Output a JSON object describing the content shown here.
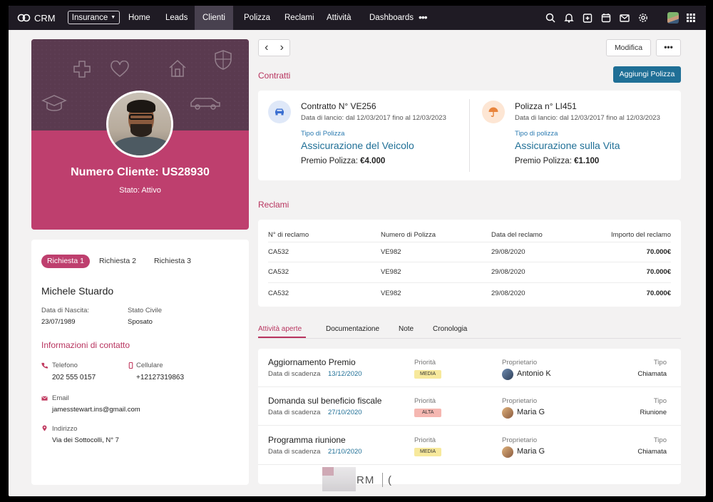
{
  "nav": {
    "logo_text": "CRM",
    "app_selector": "Insurance",
    "items": [
      "Home",
      "Leads",
      "Clienti",
      "Polizza",
      "Reclami",
      "Attività",
      "Dashboards"
    ],
    "active": "Clienti",
    "more": "•••",
    "icons": [
      "search-icon",
      "bell-icon",
      "add-note-icon",
      "calendar-icon",
      "mail-icon",
      "settings-icon",
      "user-avatar",
      "apps-grid-icon"
    ]
  },
  "profile": {
    "customer_number": "Numero Cliente: US28930",
    "status": "Stato: Attivo",
    "decor_icons": [
      "medical-cross-icon",
      "heart-icon",
      "house-icon",
      "shield-icon",
      "graduation-cap-icon",
      "car-icon"
    ]
  },
  "details": {
    "tabs": [
      "Richiesta 1",
      "Richiesta 2",
      "Richiesta 3"
    ],
    "name": "Michele Stuardo",
    "birth_label": "Data di Nascita:",
    "birth_value": "23/07/1989",
    "civil_label": "Stato Civile",
    "civil_value": "Sposato",
    "contact_title": "Informazioni di contatto",
    "phone_label": "Telefono",
    "phone_value": "202 555 0157",
    "mobile_label": "Cellulare",
    "mobile_value": "+12127319863",
    "email_label": "Email",
    "email_value": "jamesstewart.ins@gmail.com",
    "address_label": "Indirizzo",
    "address_value": "Via dei Sottocolli, N° 7"
  },
  "toolbar": {
    "prev": "‹",
    "next": "›",
    "edit_label": "Modifica",
    "more_label": "•••"
  },
  "contracts": {
    "title": "Contratti",
    "add_button": "Aggiungi Polizza",
    "items": [
      {
        "title": "Contratto N° VE256",
        "dates": "Data di lancio: dal 12/03/2017 fino al 12/03/2023",
        "type_label": "Tipo di Polizza",
        "type": "Assicurazione del Veicolo",
        "premium_label": "Premio Polizza:",
        "premium_value": "€4.000",
        "icon": "car-icon",
        "color": "#dfe8f8"
      },
      {
        "title": "Polizza n° LI451",
        "dates": "Data di lancio: dal 12/03/2017 fino al 12/03/2023",
        "type_label": "Tipo di polizza",
        "type": "Assicurazione sulla Vita",
        "premium_label": "Premio Polizza:",
        "premium_value": "€1.100",
        "icon": "umbrella-icon",
        "color": "#fde6d4"
      }
    ]
  },
  "claims": {
    "title": "Reclami",
    "headers": [
      "N° di reclamo",
      "Numero di Polizza",
      "Data del reclamo",
      "Importo del reclamo"
    ],
    "rows": [
      [
        "CA532",
        "VE982",
        "29/08/2020",
        "70.000€"
      ],
      [
        "CA532",
        "VE982",
        "29/08/2020",
        "70.000€"
      ],
      [
        "CA532",
        "VE982",
        "29/08/2020",
        "70.000€"
      ]
    ]
  },
  "activities": {
    "tabs": [
      "Attività aperte",
      "Documentazione",
      "Note",
      "Cronologia"
    ],
    "due_label": "Data di scadenza",
    "priority_label": "Priorità",
    "owner_label": "Proprietario",
    "type_label": "Tipo",
    "rows": [
      {
        "title": "Aggiornamento Premio",
        "due": "13/12/2020",
        "priority": "MEDIA",
        "owner": "Antonio K",
        "type": "Chiamata"
      },
      {
        "title": "Domanda sul beneficio fiscale",
        "due": "27/10/2020",
        "priority": "ALTA",
        "owner": "Maria G",
        "type": "Riunione"
      },
      {
        "title": "Programma riunione",
        "due": "21/10/2020",
        "priority": "MEDIA",
        "owner": "Maria G",
        "type": "Chiamata"
      }
    ]
  },
  "watermark": {
    "text": "RM",
    "trail": "("
  }
}
